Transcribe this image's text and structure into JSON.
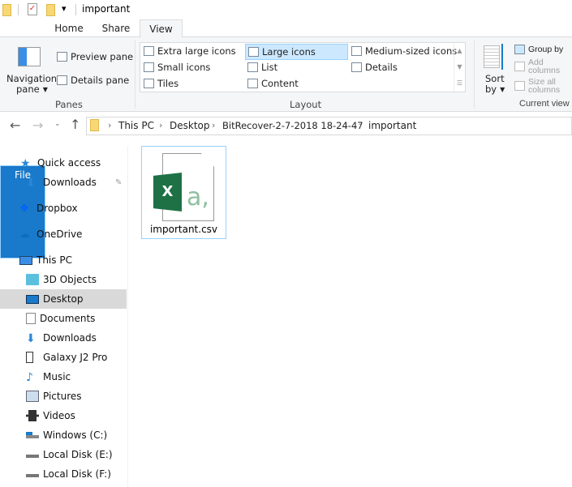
{
  "title": {
    "text": "important"
  },
  "tabs": [
    {
      "label": "File"
    },
    {
      "label": "Home"
    },
    {
      "label": "Share"
    },
    {
      "label": "View"
    }
  ],
  "ribbon": {
    "panes": {
      "nav_pane": "Navigation",
      "nav_pane2": "pane",
      "preview": "Preview pane",
      "details": "Details pane",
      "label": "Panes"
    },
    "layout": {
      "items": [
        "Extra large icons",
        "Large icons",
        "Medium-sized icons",
        "Small icons",
        "List",
        "Details",
        "Tiles",
        "Content"
      ],
      "selected": "Large icons",
      "label": "Layout"
    },
    "current_view": {
      "sort1": "Sort",
      "sort2": "by",
      "group": "Group by",
      "add": "Add columns",
      "size": "Size all columns",
      "label": "Current view"
    }
  },
  "address": {
    "crumbs": [
      "This PC",
      "Desktop",
      "BitRecover-2-7-2018 18-24-47",
      "important"
    ]
  },
  "nav": {
    "items": [
      {
        "label": "Quick access",
        "icon": "star-icon"
      },
      {
        "label": "Downloads",
        "icon": "download-icon"
      },
      {
        "label": "Dropbox",
        "icon": "dropbox-icon"
      },
      {
        "label": "OneDrive",
        "icon": "cloud-icon"
      },
      {
        "label": "This PC",
        "icon": "computer-icon"
      },
      {
        "label": "3D Objects",
        "icon": "cube-icon"
      },
      {
        "label": "Desktop",
        "icon": "desktop-icon"
      },
      {
        "label": "Documents",
        "icon": "document-icon"
      },
      {
        "label": "Downloads",
        "icon": "download-icon"
      },
      {
        "label": "Galaxy J2 Pro",
        "icon": "phone-icon"
      },
      {
        "label": "Music",
        "icon": "music-icon"
      },
      {
        "label": "Pictures",
        "icon": "pictures-icon"
      },
      {
        "label": "Videos",
        "icon": "video-icon"
      },
      {
        "label": "Windows (C:)",
        "icon": "drive-icon"
      },
      {
        "label": "Local Disk (E:)",
        "icon": "drive-icon"
      },
      {
        "label": "Local Disk (F:)",
        "icon": "drive-icon"
      }
    ]
  },
  "files": [
    {
      "name": "important.csv",
      "glyph": "X",
      "glyph2": "a,"
    }
  ],
  "colors": {
    "accent": "#1979ca",
    "excel": "#1e7145",
    "selection": "#cce8ff"
  }
}
